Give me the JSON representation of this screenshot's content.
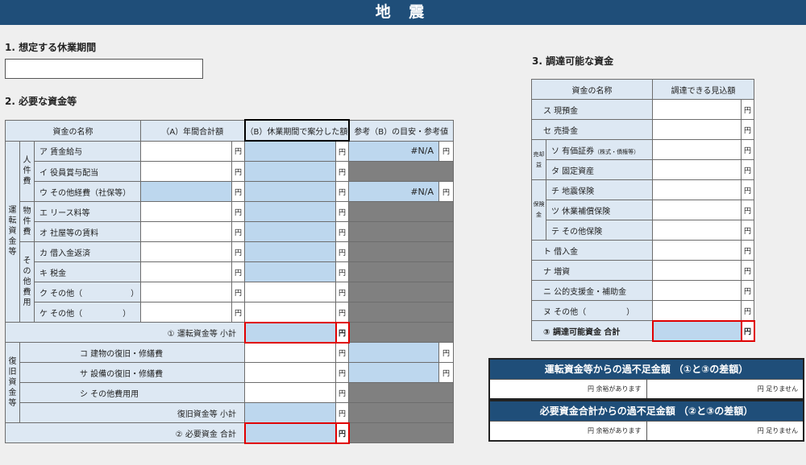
{
  "header": {
    "title": "地 震"
  },
  "sections": {
    "s1": "1. 想定する休業期間",
    "s2": "2. 必要な資金等",
    "s3": "3. 調達可能な資金"
  },
  "main_table": {
    "col_name": "資金の名称",
    "col_a": "（A）年間合計額",
    "col_b": "（B）休業期間で案分した額",
    "col_ref": "参考（B）の目安・参考値",
    "working_capital": "運転資金等",
    "personnel": "人件費",
    "property": "物件費",
    "other_costs": "その他費用",
    "recovery": "復旧資金等",
    "yen": "円",
    "na": "#N/A",
    "rows": [
      "ア 賃金給与",
      "イ 役員賞与配当",
      "ウ その他経費（社保等）",
      "エ リース料等",
      "オ 社屋等の賃料",
      "カ 借入金返済",
      "キ 税金",
      "ク その他（　　　　　　）",
      "ケ その他（　　　　　）"
    ],
    "subtotal1": "① 運転資金等 小計",
    "recovery_rows": [
      "コ 建物の復旧・修繕費",
      "サ 設備の復旧・修繕費",
      "シ その他費用用"
    ],
    "subtotal_recovery": "復旧資金等 小計",
    "total2": "② 必要資金 合計"
  },
  "funds_table": {
    "col_name": "資金の名称",
    "col_amount": "調達できる見込額",
    "securities": "売却益",
    "insurance": "保険金",
    "rows": [
      "ス 現預金",
      "セ 売掛金",
      "ソ 有価証券",
      "タ 固定資産",
      "チ 地震保険",
      "ツ 休業補償保険",
      "テ その他保険",
      "ト 借入金",
      "ナ 増資",
      "ニ 公的支援金・補助金",
      "ヌ その他（　　　　　）"
    ],
    "securities_note": "（株式・債権等）",
    "total3": "③ 調達可能資金 合計",
    "yen": "円"
  },
  "summary": {
    "box1_title": "運転資金等からの過不足金額 （①と③の差額）",
    "box2_title": "必要資金合計からの過不足金額 （②と③の差額）",
    "surplus": "円 余裕があります",
    "shortage": "円 足りません"
  }
}
